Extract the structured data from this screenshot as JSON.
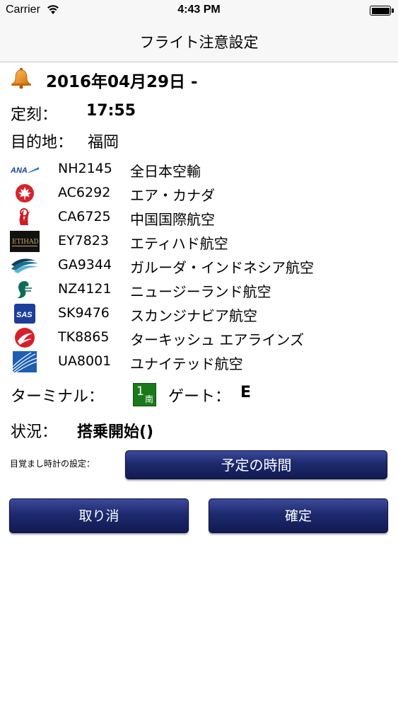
{
  "status_bar": {
    "carrier": "Carrier",
    "time": "4:43 PM"
  },
  "nav": {
    "title": "フライト注意設定"
  },
  "flight": {
    "date": "2016年04月29日 -",
    "departure_label": "定刻：",
    "departure_time": "17:55",
    "destination_label": "目的地：",
    "destination": "福岡",
    "codeshares": [
      {
        "code": "NH2145",
        "airline": "全日本空輸",
        "logo": "ana-logo-icon"
      },
      {
        "code": "AC6292",
        "airline": "エア・カナダ",
        "logo": "air-canada-logo-icon"
      },
      {
        "code": "CA6725",
        "airline": "中国国際航空",
        "logo": "air-china-logo-icon"
      },
      {
        "code": "EY7823",
        "airline": "エティハド航空",
        "logo": "etihad-logo-icon"
      },
      {
        "code": "GA9344",
        "airline": "ガルーダ・インドネシア航空",
        "logo": "garuda-logo-icon"
      },
      {
        "code": "NZ4121",
        "airline": "ニュージーランド航空",
        "logo": "air-new-zealand-logo-icon"
      },
      {
        "code": "SK9476",
        "airline": "スカンジナビア航空",
        "logo": "sas-logo-icon"
      },
      {
        "code": "TK8865",
        "airline": "ターキッシュ エアラインズ",
        "logo": "turkish-airlines-logo-icon"
      },
      {
        "code": "UA8001",
        "airline": "ユナイテッド航空",
        "logo": "united-logo-icon"
      }
    ],
    "terminal_label": "ターミナル：",
    "terminal_number": "1",
    "terminal_sub": "南",
    "gate_label": "ゲート：",
    "gate": "E",
    "status_label": "状況：",
    "status": "搭乗開始()"
  },
  "alarm": {
    "label": "目覚まし時計の設定：",
    "button_label": "予定の時間"
  },
  "actions": {
    "cancel_label": "取り消",
    "confirm_label": "確定"
  },
  "colors": {
    "button_navy": "#1d2a6e",
    "terminal_green": "#1a7a1a",
    "bell_orange": "#e8901c"
  }
}
